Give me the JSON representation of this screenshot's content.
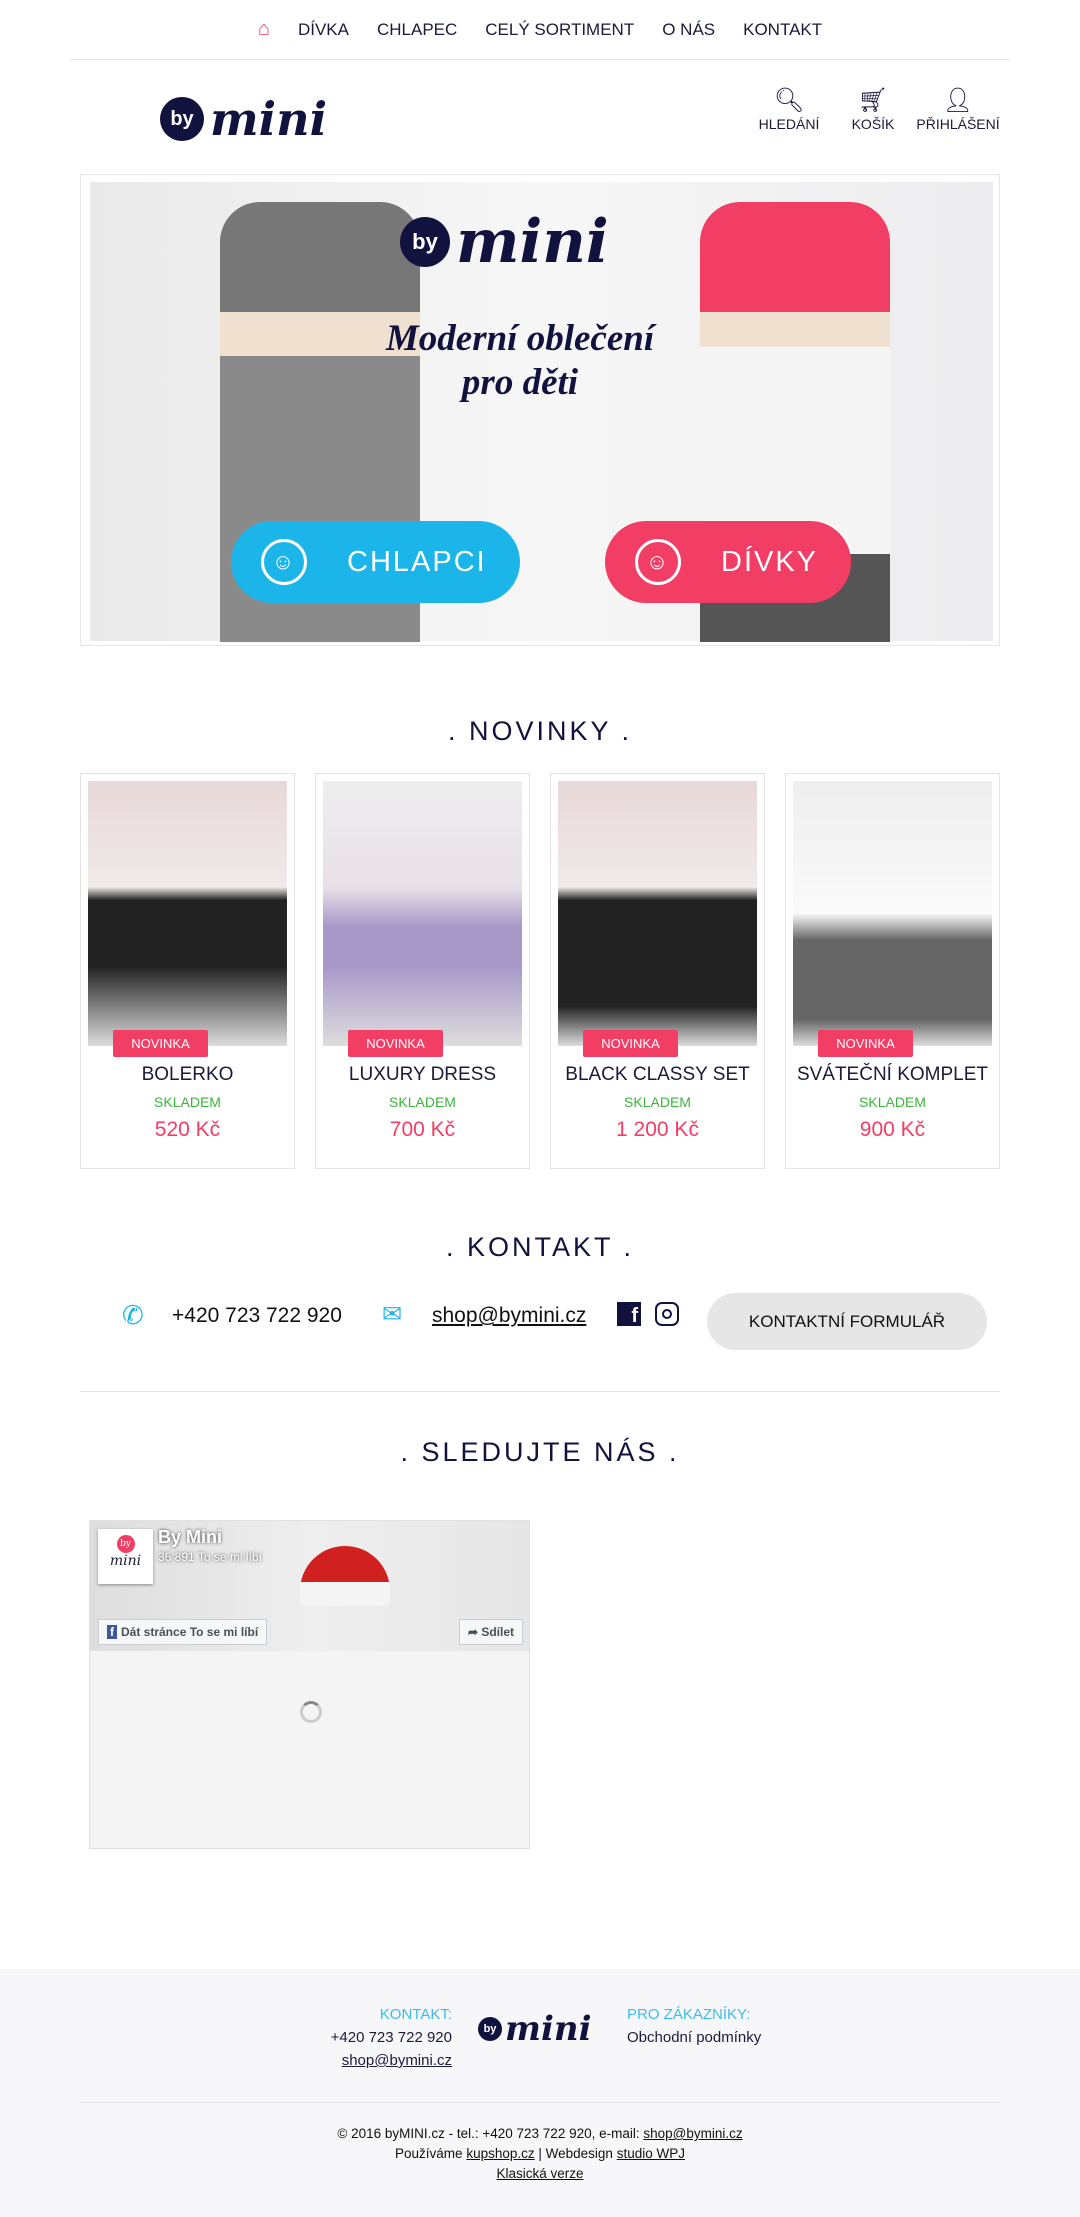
{
  "top_nav": {
    "home_icon": "home-icon",
    "items": [
      "DÍVKA",
      "CHLAPEC",
      "CELÝ SORTIMENT",
      "O NÁS",
      "KONTAKT"
    ]
  },
  "logo": {
    "by": "by",
    "mini": "mini"
  },
  "header_actions": [
    {
      "icon": "search-icon",
      "label": "HLEDÁNÍ"
    },
    {
      "icon": "cart-icon",
      "label": "KOŠÍK"
    },
    {
      "icon": "user-icon",
      "label": "PŘIHLÁŠENÍ"
    }
  ],
  "hero": {
    "line1": "Moderní oblečení",
    "line2": "pro děti",
    "boys_label": "CHLAPCI",
    "girls_label": "DÍVKY",
    "boys_color": "#1cb5ea",
    "girls_color": "#f23d65"
  },
  "novinky": {
    "title": ". NOVINKY .",
    "products": [
      {
        "badge": "NOVINKA",
        "name": "BOLERKO",
        "stock": "SKLADEM",
        "price": "520 Kč"
      },
      {
        "badge": "NOVINKA",
        "name": "LUXURY DRESS",
        "stock": "SKLADEM",
        "price": "700 Kč"
      },
      {
        "badge": "NOVINKA",
        "name": "BLACK CLASSY SET",
        "stock": "SKLADEM",
        "price": "1 200 Kč"
      },
      {
        "badge": "NOVINKA",
        "name": "SVÁTEČNÍ KOMPLET",
        "stock": "SKLADEM",
        "price": "900 Kč"
      }
    ]
  },
  "kontakt": {
    "title": ". KONTAKT .",
    "phone": "+420 723 722 920",
    "email": "shop@bymini.cz",
    "form_button": "KONTAKTNÍ FORMULÁŘ"
  },
  "social": {
    "title": ". SLEDUJTE NÁS .",
    "page_name": "By Mini",
    "likes": "36 891 To se mi líbí",
    "like_button": "Dát stránce To se mi líbí",
    "share_button": "Sdílet"
  },
  "footer": {
    "contact_label": "KONTAKT:",
    "phone": "+420 723 722 920",
    "email": "shop@bymini.cz",
    "customers_label": "PRO ZÁKAZNÍKY:",
    "terms": "Obchodní podmínky",
    "copyright": "© 2016 byMINI.cz - tel.: +420 723 722 920, e-mail: ",
    "copyright_email": "shop@bymini.cz",
    "uses": "Používáme ",
    "kupshop": "kupshop.cz",
    "webdesign": " | Webdesign ",
    "studio": "studio WPJ",
    "classic": "Klasická verze"
  },
  "colors": {
    "accent_pink": "#f23d65",
    "accent_blue": "#1cb5ea",
    "navy": "#12123f"
  }
}
